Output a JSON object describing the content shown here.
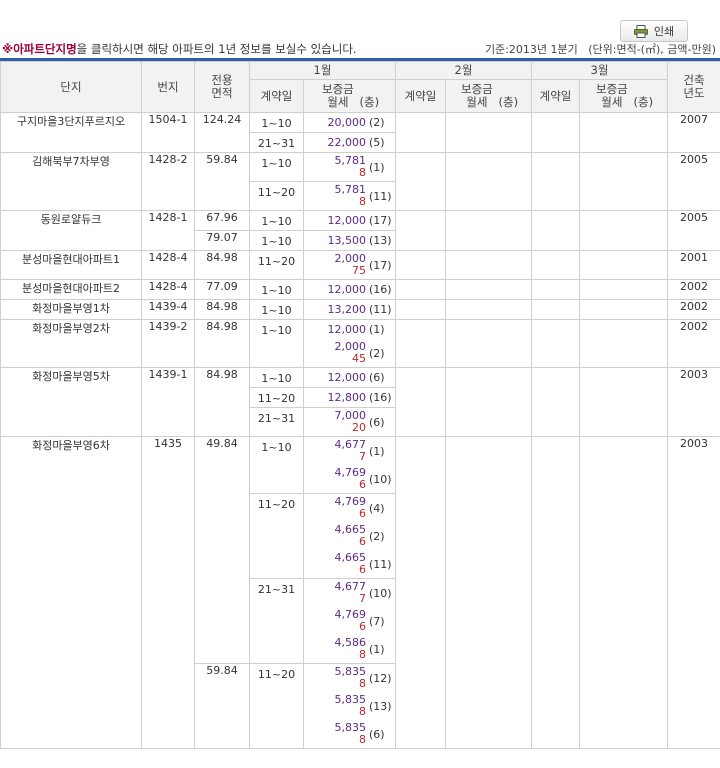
{
  "print_button": {
    "label": "인쇄"
  },
  "notice": {
    "mark": "※",
    "link_text": "아파트단지명",
    "message": "을 클릭하시면 해당 아파트의 1년 정보를 보실수 있습니다.",
    "basis": "기준:2013년 1분기",
    "units": "(단위:면적-(㎡), 금액-만원)"
  },
  "headers": {
    "complex": "단지",
    "lot": "번지",
    "area": "전용면적",
    "built": "건축년도",
    "months": [
      "1월",
      "2월",
      "3월"
    ],
    "contract_day": "계약일",
    "deposit_rent": "보증금월세",
    "floor_label": "(층)"
  },
  "complexes": [
    {
      "name": "구지마을3단지푸르지오",
      "lot": "1504-1",
      "built": "2007",
      "areas": [
        {
          "area": "124.24",
          "periods": [
            {
              "days": "1~10",
              "entries": [
                {
                  "deposit": "20,000",
                  "floor": "(2)"
                }
              ]
            },
            {
              "days": "21~31",
              "entries": [
                {
                  "deposit": "22,000",
                  "floor": "(5)"
                }
              ]
            }
          ]
        }
      ]
    },
    {
      "name": "김해북부7차부영",
      "lot": "1428-2",
      "built": "2005",
      "areas": [
        {
          "area": "59.84",
          "periods": [
            {
              "days": "1~10",
              "entries": [
                {
                  "deposit": "5,781",
                  "rent": "8",
                  "floor": "(1)"
                }
              ]
            },
            {
              "days": "11~20",
              "entries": [
                {
                  "deposit": "5,781",
                  "rent": "8",
                  "floor": "(11)"
                }
              ]
            }
          ]
        }
      ]
    },
    {
      "name": "동원로얄듀크",
      "lot": "1428-1",
      "built": "2005",
      "areas": [
        {
          "area": "67.96",
          "periods": [
            {
              "days": "1~10",
              "entries": [
                {
                  "deposit": "12,000",
                  "floor": "(17)"
                }
              ]
            }
          ]
        },
        {
          "area": "79.07",
          "periods": [
            {
              "days": "1~10",
              "entries": [
                {
                  "deposit": "13,500",
                  "floor": "(13)"
                }
              ]
            }
          ]
        }
      ]
    },
    {
      "name": "분성마을현대아파트1",
      "lot": "1428-4",
      "built": "2001",
      "areas": [
        {
          "area": "84.98",
          "periods": [
            {
              "days": "11~20",
              "entries": [
                {
                  "deposit": "2,000",
                  "rent": "75",
                  "floor": "(17)"
                }
              ]
            }
          ]
        }
      ]
    },
    {
      "name": "분성마을현대아파트2",
      "lot": "1428-4",
      "built": "2002",
      "areas": [
        {
          "area": "77.09",
          "periods": [
            {
              "days": "1~10",
              "entries": [
                {
                  "deposit": "12,000",
                  "floor": "(16)"
                }
              ]
            }
          ]
        }
      ]
    },
    {
      "name": "화정마을부영1차",
      "lot": "1439-4",
      "built": "2002",
      "areas": [
        {
          "area": "84.98",
          "periods": [
            {
              "days": "1~10",
              "entries": [
                {
                  "deposit": "13,200",
                  "floor": "(11)"
                }
              ]
            }
          ]
        }
      ]
    },
    {
      "name": "화정마을부영2차",
      "lot": "1439-2",
      "built": "2002",
      "areas": [
        {
          "area": "84.98",
          "periods": [
            {
              "days": "1~10",
              "entries": [
                {
                  "deposit": "12,000",
                  "floor": "(1)"
                },
                {
                  "deposit": "2,000",
                  "rent": "45",
                  "floor": "(2)"
                }
              ]
            }
          ]
        }
      ]
    },
    {
      "name": "화정마을부영5차",
      "lot": "1439-1",
      "built": "2003",
      "areas": [
        {
          "area": "84.98",
          "periods": [
            {
              "days": "1~10",
              "entries": [
                {
                  "deposit": "12,000",
                  "floor": "(6)"
                }
              ]
            },
            {
              "days": "11~20",
              "entries": [
                {
                  "deposit": "12,800",
                  "floor": "(16)"
                }
              ]
            },
            {
              "days": "21~31",
              "entries": [
                {
                  "deposit": "7,000",
                  "rent": "20",
                  "floor": "(6)"
                }
              ]
            }
          ]
        }
      ]
    },
    {
      "name": "화정마을부영6차",
      "lot": "1435",
      "built": "2003",
      "areas": [
        {
          "area": "49.84",
          "periods": [
            {
              "days": "1~10",
              "entries": [
                {
                  "deposit": "4,677",
                  "rent": "7",
                  "floor": "(1)"
                },
                {
                  "deposit": "4,769",
                  "rent": "6",
                  "floor": "(10)"
                }
              ]
            },
            {
              "days": "11~20",
              "entries": [
                {
                  "deposit": "4,769",
                  "rent": "6",
                  "floor": "(4)"
                },
                {
                  "deposit": "4,665",
                  "rent": "6",
                  "floor": "(2)"
                },
                {
                  "deposit": "4,665",
                  "rent": "6",
                  "floor": "(11)"
                }
              ]
            },
            {
              "days": "21~31",
              "entries": [
                {
                  "deposit": "4,677",
                  "rent": "7",
                  "floor": "(10)"
                },
                {
                  "deposit": "4,769",
                  "rent": "6",
                  "floor": "(7)"
                },
                {
                  "deposit": "4,586",
                  "rent": "8",
                  "floor": "(1)"
                }
              ]
            }
          ]
        },
        {
          "area": "59.84",
          "periods": [
            {
              "days": "11~20",
              "entries": [
                {
                  "deposit": "5,835",
                  "rent": "8",
                  "floor": "(12)"
                },
                {
                  "deposit": "5,835",
                  "rent": "8",
                  "floor": "(13)"
                },
                {
                  "deposit": "5,835",
                  "rent": "8",
                  "floor": "(6)"
                }
              ]
            }
          ]
        }
      ]
    }
  ]
}
